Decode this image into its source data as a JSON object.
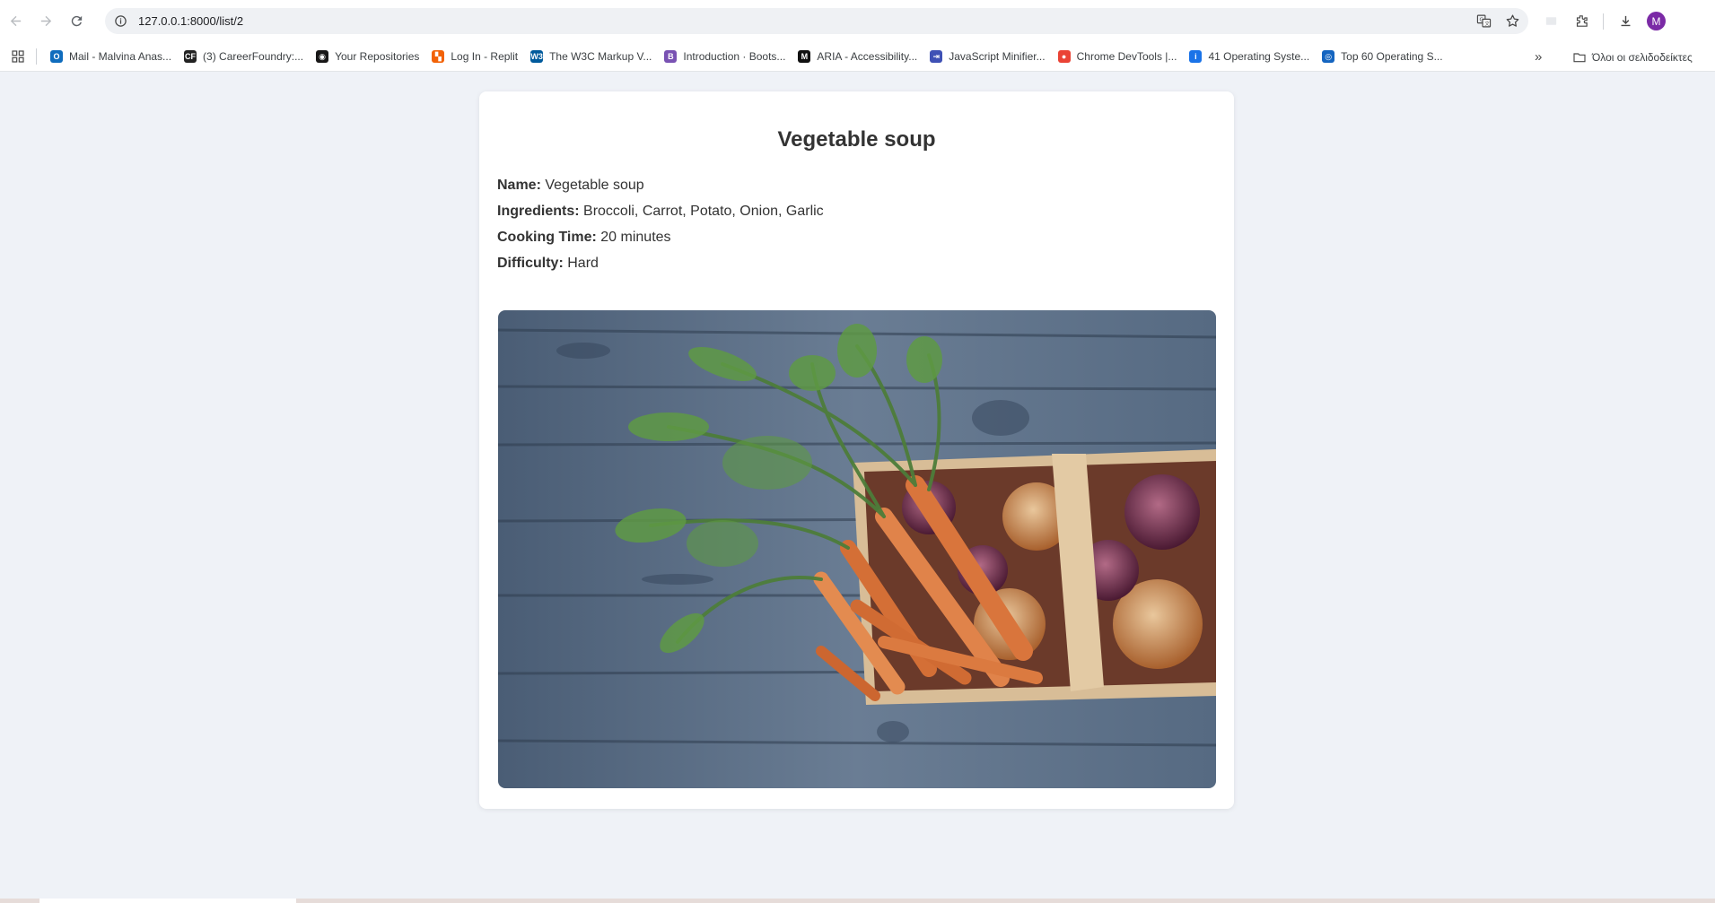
{
  "browser": {
    "url": "127.0.0.1:8000/list/2",
    "profile_initial": "M",
    "bookmarks": [
      {
        "label": "Mail - Malvina Anas...",
        "icon": "outlook-icon",
        "color": "#0f6cbd",
        "glyph": "O"
      },
      {
        "label": "(3) CareerFoundry:...",
        "icon": "careerfoundry-icon",
        "color": "#222222",
        "glyph": "CF"
      },
      {
        "label": "Your Repositories",
        "icon": "github-icon",
        "color": "#181717",
        "glyph": "◉"
      },
      {
        "label": "Log In - Replit",
        "icon": "replit-icon",
        "color": "#f26207",
        "glyph": "▚"
      },
      {
        "label": "The W3C Markup V...",
        "icon": "w3c-icon",
        "color": "#005a9c",
        "glyph": "W3"
      },
      {
        "label": "Introduction · Boots...",
        "icon": "bootstrap-icon",
        "color": "#7952b3",
        "glyph": "B"
      },
      {
        "label": "ARIA - Accessibility...",
        "icon": "mdn-icon",
        "color": "#111111",
        "glyph": "M"
      },
      {
        "label": "JavaScript Minifier...",
        "icon": "jsminifier-icon",
        "color": "#3f51b5",
        "glyph": "⇥"
      },
      {
        "label": "Chrome DevTools |...",
        "icon": "chrome-icon",
        "color": "#ea4335",
        "glyph": "●"
      },
      {
        "label": "41 Operating Syste...",
        "icon": "info-site-icon",
        "color": "#1a73e8",
        "glyph": "i"
      },
      {
        "label": "Top 60 Operating S...",
        "icon": "top60-icon",
        "color": "#1565c0",
        "glyph": "◎"
      }
    ],
    "more_label": "»",
    "all_bookmarks_label": "Όλοι οι σελιδοδείκτες"
  },
  "recipe": {
    "title": "Vegetable soup",
    "name_label": "Name:",
    "name": "Vegetable soup",
    "ingredients_label": "Ingredients:",
    "ingredients": "Broccoli, Carrot, Potato, Onion, Garlic",
    "cooking_time_label": "Cooking Time:",
    "cooking_time": "20 minutes",
    "difficulty_label": "Difficulty:",
    "difficulty": "Hard"
  }
}
